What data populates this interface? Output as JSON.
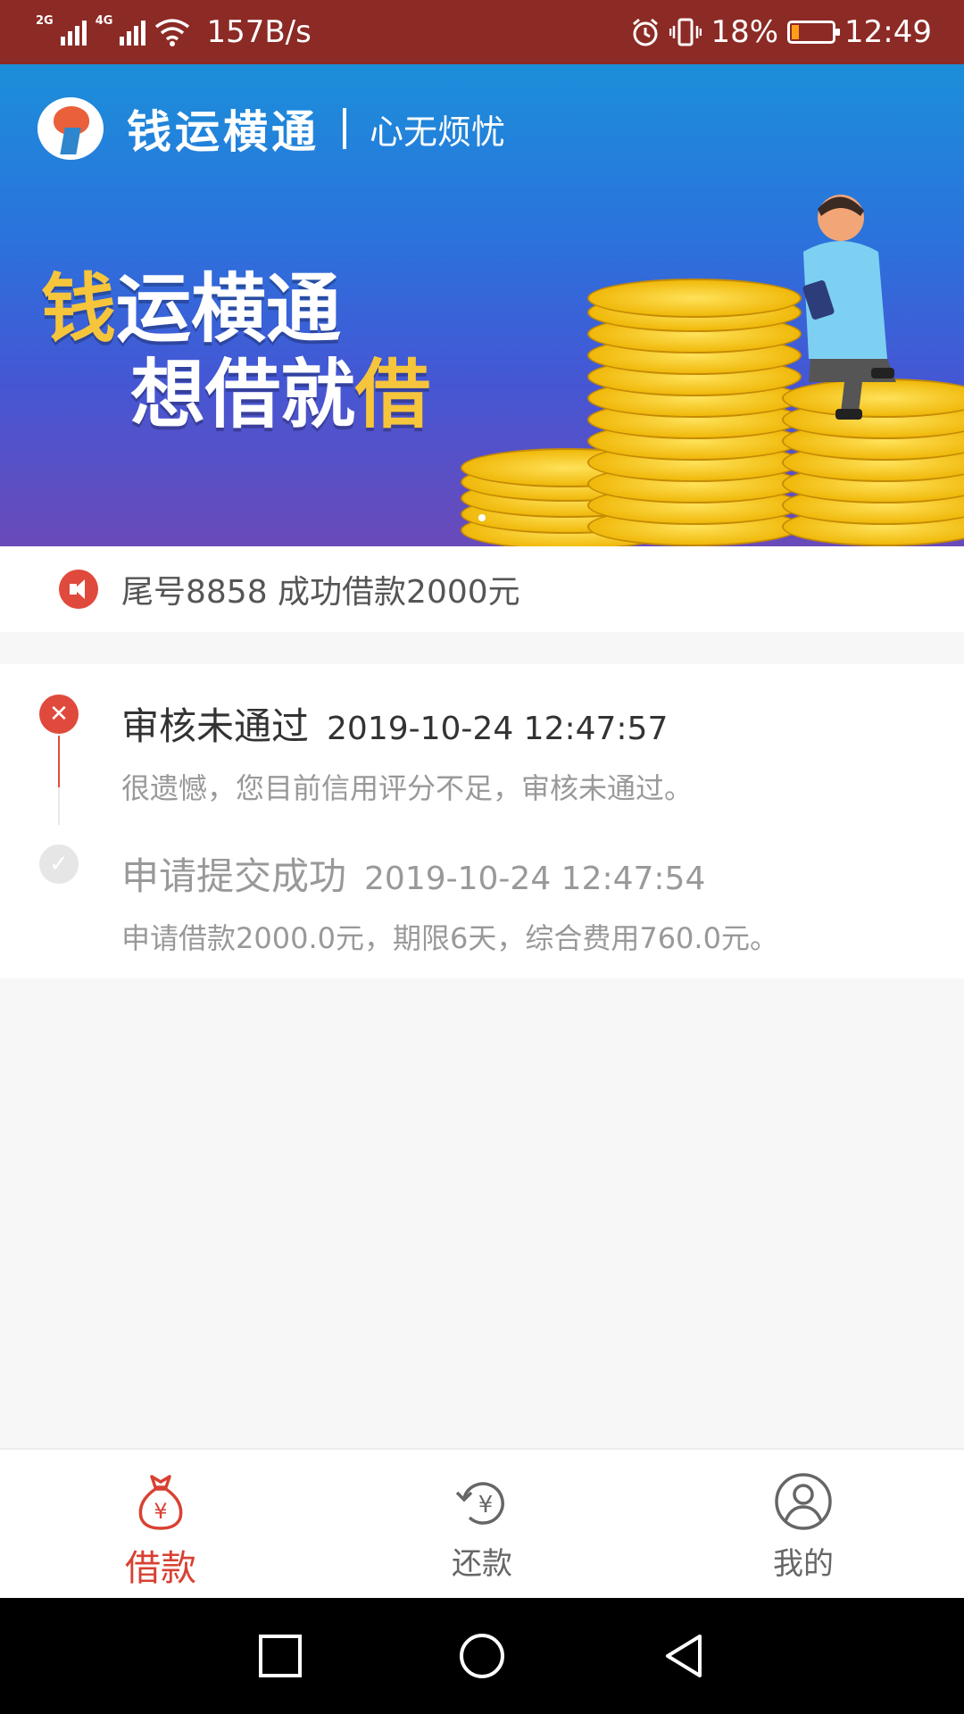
{
  "status_bar": {
    "network_1": "2G",
    "network_2": "4G",
    "speed": "157B/s",
    "battery": "18%",
    "time": "12:49",
    "battery_level": 0.18
  },
  "banner": {
    "brand_name": "钱运横通",
    "slogan": "心无烦忧",
    "headline_1a": "钱",
    "headline_1b": "运横通",
    "headline_2a": "想借就",
    "headline_2b": "借"
  },
  "notice": {
    "text": "尾号8858 成功借款2000元"
  },
  "timeline": [
    {
      "title": "审核未通过",
      "time": "2019-10-24 12:47:57",
      "desc": "很遗憾，您目前信用评分不足，审核未通过。",
      "status": "failed"
    },
    {
      "title": "申请提交成功",
      "time": "2019-10-24 12:47:54",
      "desc": "申请借款2000.0元，期限6天，综合费用760.0元。",
      "status": "done"
    }
  ],
  "tabs": [
    {
      "label": "借款",
      "icon": "money-bag-icon",
      "active": true
    },
    {
      "label": "还款",
      "icon": "repay-icon",
      "active": false
    },
    {
      "label": "我的",
      "icon": "profile-icon",
      "active": false
    }
  ],
  "colors": {
    "status_bar": "#8c2a25",
    "accent_red": "#e04a3c",
    "tab_active": "#d84132"
  }
}
